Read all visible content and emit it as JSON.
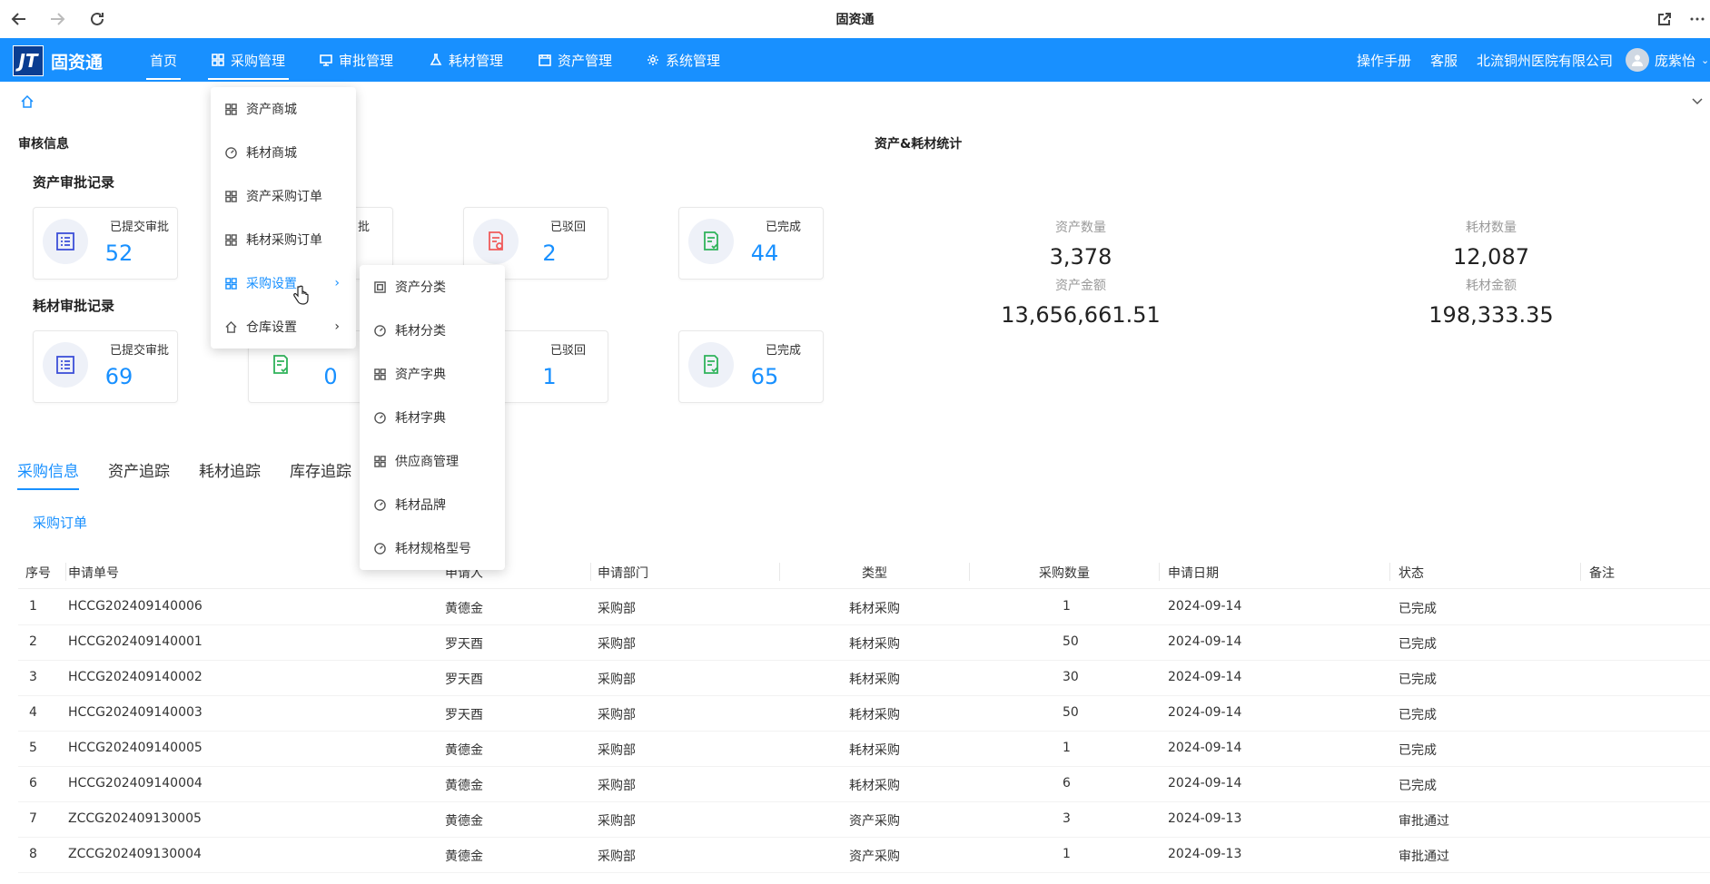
{
  "window": {
    "title": "固资通"
  },
  "brand": {
    "logo_mark": "JT",
    "name": "固资通"
  },
  "nav": {
    "items": [
      {
        "label": "首页",
        "icon": "home"
      },
      {
        "label": "采购管理",
        "icon": "grid-icon"
      },
      {
        "label": "审批管理",
        "icon": "monitor-icon"
      },
      {
        "label": "耗材管理",
        "icon": "flask-icon"
      },
      {
        "label": "资产管理",
        "icon": "calendar-icon"
      },
      {
        "label": "系统管理",
        "icon": "gear-icon"
      }
    ],
    "right": {
      "manual": "操作手册",
      "service": "客服",
      "company": "北流铜州医院有限公司",
      "user": "庞紫怡"
    }
  },
  "audit": {
    "title": "审核信息",
    "asset": {
      "title": "资产审批记录",
      "cards": [
        {
          "label": "已提交审批",
          "value": "52"
        },
        {
          "label": "已驳回",
          "value": "2"
        },
        {
          "label": "已完成",
          "value": "44"
        }
      ]
    },
    "consumable": {
      "title": "耗材审批记录",
      "cards": [
        {
          "label": "已提交审批",
          "value": "69"
        },
        {
          "label": "",
          "value": "0"
        },
        {
          "label": "已驳回",
          "value": "1"
        },
        {
          "label": "已完成",
          "value": "65"
        }
      ]
    },
    "partial_label": "批"
  },
  "stats": {
    "title": "资产&耗材统计",
    "asset_count_label": "资产数量",
    "asset_count": "3,378",
    "asset_amount_label": "资产金额",
    "asset_amount": "13,656,661.51",
    "consumable_count_label": "耗材数量",
    "consumable_count": "12,087",
    "consumable_amount_label": "耗材金额",
    "consumable_amount": "198,333.35"
  },
  "tabs": [
    "采购信息",
    "资产追踪",
    "耗材追踪",
    "库存追踪"
  ],
  "subtab": "采购订单",
  "table": {
    "headers": [
      "序号",
      "申请单号",
      "申请人",
      "申请部门",
      "类型",
      "采购数量",
      "申请日期",
      "状态",
      "备注"
    ],
    "rows": [
      [
        "1",
        "HCCG202409140006",
        "黄德金",
        "采购部",
        "耗材采购",
        "1",
        "2024-09-14",
        "已完成"
      ],
      [
        "2",
        "HCCG202409140001",
        "罗天酉",
        "采购部",
        "耗材采购",
        "50",
        "2024-09-14",
        "已完成"
      ],
      [
        "3",
        "HCCG202409140002",
        "罗天酉",
        "采购部",
        "耗材采购",
        "30",
        "2024-09-14",
        "已完成"
      ],
      [
        "4",
        "HCCG202409140003",
        "罗天酉",
        "采购部",
        "耗材采购",
        "50",
        "2024-09-14",
        "已完成"
      ],
      [
        "5",
        "HCCG202409140005",
        "黄德金",
        "采购部",
        "耗材采购",
        "1",
        "2024-09-14",
        "已完成"
      ],
      [
        "6",
        "HCCG202409140004",
        "黄德金",
        "采购部",
        "耗材采购",
        "6",
        "2024-09-14",
        "已完成"
      ],
      [
        "7",
        "ZCCG202409130005",
        "黄德金",
        "采购部",
        "资产采购",
        "3",
        "2024-09-13",
        "审批通过"
      ],
      [
        "8",
        "ZCCG202409130004",
        "黄德金",
        "采购部",
        "资产采购",
        "1",
        "2024-09-13",
        "审批通过"
      ]
    ]
  },
  "menu_purchase": [
    {
      "label": "资产商城",
      "icon": "grid-icon"
    },
    {
      "label": "耗材商城",
      "icon": "gauge-icon"
    },
    {
      "label": "资产采购订单",
      "icon": "grid-icon"
    },
    {
      "label": "耗材采购订单",
      "icon": "grid-icon"
    },
    {
      "label": "采购设置",
      "icon": "grid-icon"
    },
    {
      "label": "仓库设置",
      "icon": "home-icon"
    }
  ],
  "menu_settings": [
    {
      "label": "资产分类",
      "icon": "square-icon"
    },
    {
      "label": "耗材分类",
      "icon": "gauge-icon"
    },
    {
      "label": "资产字典",
      "icon": "grid-icon"
    },
    {
      "label": "耗材字典",
      "icon": "gauge-icon"
    },
    {
      "label": "供应商管理",
      "icon": "grid-icon"
    },
    {
      "label": "耗材品牌",
      "icon": "gauge-icon"
    },
    {
      "label": "耗材规格型号",
      "icon": "gauge-icon"
    }
  ]
}
